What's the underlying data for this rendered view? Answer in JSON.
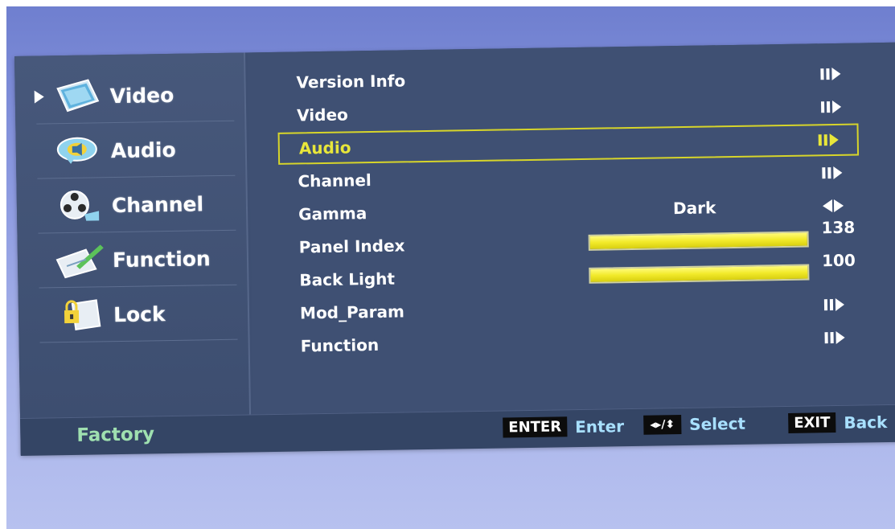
{
  "sidebar": {
    "items": [
      {
        "label": "Video",
        "icon": "video-icon",
        "selected": true
      },
      {
        "label": "Audio",
        "icon": "audio-icon",
        "selected": false
      },
      {
        "label": "Channel",
        "icon": "channel-icon",
        "selected": false
      },
      {
        "label": "Function",
        "icon": "function-icon",
        "selected": false
      },
      {
        "label": "Lock",
        "icon": "lock-icon",
        "selected": false
      }
    ]
  },
  "menu": {
    "rows": [
      {
        "label": "Version Info",
        "control": "enter-arrow"
      },
      {
        "label": "Video",
        "control": "enter-arrow"
      },
      {
        "label": "Audio",
        "control": "enter-arrow",
        "highlighted": true
      },
      {
        "label": "Channel",
        "control": "enter-arrow"
      },
      {
        "label": "Gamma",
        "control": "left-right",
        "value": "Dark"
      },
      {
        "label": "Panel Index",
        "control": "slider",
        "value": "138",
        "level": 1.0
      },
      {
        "label": "Back Light",
        "control": "slider",
        "value": "100",
        "level": 1.0
      },
      {
        "label": "Mod_Param",
        "control": "enter-arrow"
      },
      {
        "label": "Function",
        "control": "enter-arrow"
      }
    ]
  },
  "footer": {
    "title": "Factory",
    "enter_key": "ENTER",
    "enter_label": "Enter",
    "select_key": "◂▸/⬍",
    "select_label": "Select",
    "exit_key": "EXIT",
    "exit_label": "Back"
  },
  "colors": {
    "highlight": "#e8e63a",
    "footer_title": "#9fe0b0",
    "hint_label": "#a8e0ff",
    "panel": "#3f5073"
  }
}
